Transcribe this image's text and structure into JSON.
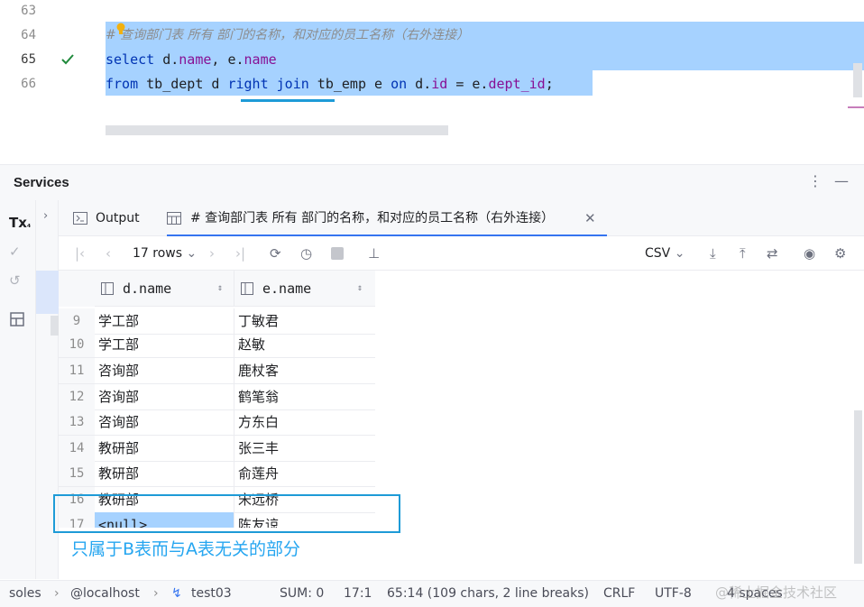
{
  "editor": {
    "line_numbers": [
      "63",
      "64",
      "65",
      "66"
    ],
    "run_status_icon": "check-icon",
    "comment": "# 查询部门表 所有 部门的名称，和对应的员工名称（右外连接）",
    "line65": {
      "kw_select": "select",
      "p1": " d.",
      "f1": "name",
      "p2": ", e.",
      "f2": "name"
    },
    "line66": {
      "kw_from": "from",
      "p1": " tb_dept d ",
      "kw_right": "right",
      "sp": " ",
      "kw_join": "join",
      "p2": " tb_emp e ",
      "kw_on": "on",
      "p3": " d.",
      "f1": "id",
      "p4": " = e.",
      "f2": "dept_id",
      "p5": ";"
    }
  },
  "services": {
    "title": "Services",
    "more_icon": "more-vertical-icon",
    "minimize_icon": "minimize-icon",
    "left_tools": {
      "tx_label": "Tx",
      "tx_sub": "₄"
    },
    "tabs": [
      {
        "label": "Output"
      },
      {
        "label": "# 查询部门表 所有 部门的名称，和对应的员工名称（右外连接）"
      }
    ],
    "toolbar": {
      "rows_label": "17 rows",
      "export_format": "CSV"
    }
  },
  "grid": {
    "columns": [
      "d.name",
      "e.name"
    ],
    "rows": [
      {
        "n": "9",
        "d": "学工部",
        "e": "丁敏君"
      },
      {
        "n": "10",
        "d": "学工部",
        "e": "赵敏"
      },
      {
        "n": "11",
        "d": "咨询部",
        "e": "鹿杖客"
      },
      {
        "n": "12",
        "d": "咨询部",
        "e": "鹤笔翁"
      },
      {
        "n": "13",
        "d": "咨询部",
        "e": "方东白"
      },
      {
        "n": "14",
        "d": "教研部",
        "e": "张三丰"
      },
      {
        "n": "15",
        "d": "教研部",
        "e": "俞莲舟"
      },
      {
        "n": "16",
        "d": "教研部",
        "e": "宋远桥"
      },
      {
        "n": "17",
        "d": "<null>",
        "e": "陈友谅"
      }
    ]
  },
  "annotation": "只属于B表而与A表无关的部分",
  "status": {
    "crumb1": "soles",
    "crumb2": "@localhost",
    "crumb3": "test03",
    "sum": "SUM: 0",
    "position": "17:1",
    "selection": "65:14 (109 chars, 2 line breaks)",
    "line_ending": "CRLF",
    "encoding": "UTF-8",
    "indent": "4 spaces"
  },
  "watermark": "@稀土掘金技术社区",
  "colors": {
    "selection": "#a6d2ff",
    "keyword": "#0033b3",
    "field": "#871094",
    "annotation": "#26a6f0",
    "box": "#1e9bd7"
  }
}
